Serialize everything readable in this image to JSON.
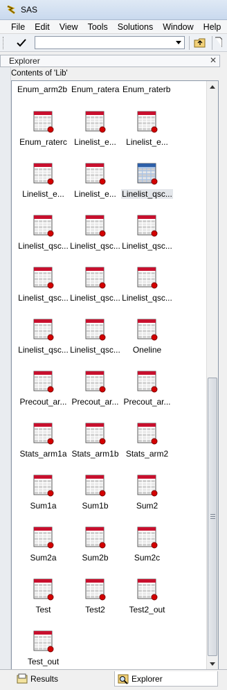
{
  "window": {
    "title": "SAS"
  },
  "menu": [
    "File",
    "Edit",
    "View",
    "Tools",
    "Solutions",
    "Window",
    "Help"
  ],
  "toolbar": {
    "command_value": ""
  },
  "explorer": {
    "title": "Explorer",
    "contents_label": "Contents of 'Lib'"
  },
  "top_row": [
    "Enum_arm2b",
    "Enum_ratera",
    "Enum_raterb"
  ],
  "items": [
    {
      "label": "Enum_raterc",
      "selected": false
    },
    {
      "label": "Linelist_e...",
      "selected": false
    },
    {
      "label": "Linelist_e...",
      "selected": false
    },
    {
      "label": "Linelist_e...",
      "selected": false
    },
    {
      "label": "Linelist_e...",
      "selected": false
    },
    {
      "label": "Linelist_qsc...",
      "selected": true
    },
    {
      "label": "Linelist_qsc...",
      "selected": false
    },
    {
      "label": "Linelist_qsc...",
      "selected": false
    },
    {
      "label": "Linelist_qsc...",
      "selected": false
    },
    {
      "label": "Linelist_qsc...",
      "selected": false
    },
    {
      "label": "Linelist_qsc...",
      "selected": false
    },
    {
      "label": "Linelist_qsc...",
      "selected": false
    },
    {
      "label": "Linelist_qsc...",
      "selected": false
    },
    {
      "label": "Linelist_qsc...",
      "selected": false
    },
    {
      "label": "Oneline",
      "selected": false
    },
    {
      "label": "Precout_ar...",
      "selected": false
    },
    {
      "label": "Precout_ar...",
      "selected": false
    },
    {
      "label": "Precout_ar...",
      "selected": false
    },
    {
      "label": "Stats_arm1a",
      "selected": false
    },
    {
      "label": "Stats_arm1b",
      "selected": false
    },
    {
      "label": "Stats_arm2",
      "selected": false
    },
    {
      "label": "Sum1a",
      "selected": false
    },
    {
      "label": "Sum1b",
      "selected": false
    },
    {
      "label": "Sum2",
      "selected": false
    },
    {
      "label": "Sum2a",
      "selected": false
    },
    {
      "label": "Sum2b",
      "selected": false
    },
    {
      "label": "Sum2c",
      "selected": false
    },
    {
      "label": "Test",
      "selected": false
    },
    {
      "label": "Test2",
      "selected": false
    },
    {
      "label": "Test2_out",
      "selected": false
    },
    {
      "label": "Test_out",
      "selected": false
    }
  ],
  "tabs": [
    {
      "label": "Results",
      "icon": "results-icon",
      "active": false
    },
    {
      "label": "Explorer",
      "icon": "explorer-icon",
      "active": true
    }
  ],
  "colors": {
    "table_red": "#c8102e",
    "table_blue": "#2d5fa8",
    "selection": "#e3e6ea"
  }
}
